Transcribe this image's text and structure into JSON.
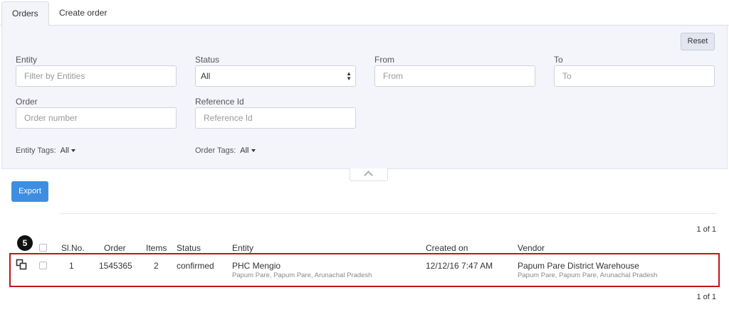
{
  "tabs": [
    {
      "label": "Orders",
      "active": true
    },
    {
      "label": "Create order",
      "active": false
    }
  ],
  "filters": {
    "reset_label": "Reset",
    "entity": {
      "label": "Entity",
      "placeholder": "Filter by Entities"
    },
    "status": {
      "label": "Status",
      "value": "All"
    },
    "from": {
      "label": "From",
      "placeholder": "From"
    },
    "to": {
      "label": "To",
      "placeholder": "To"
    },
    "order": {
      "label": "Order",
      "placeholder": "Order number"
    },
    "reference": {
      "label": "Reference Id",
      "placeholder": "Reference Id"
    },
    "entity_tags": {
      "label": "Entity Tags:",
      "value": "All"
    },
    "order_tags": {
      "label": "Order Tags:",
      "value": "All"
    }
  },
  "export_label": "Export",
  "pagination_top": "1 of 1",
  "pagination_bottom": "1 of 1",
  "step_marker": "5",
  "table": {
    "headers": {
      "slno": "Sl.No.",
      "order": "Order",
      "items": "Items",
      "status": "Status",
      "entity": "Entity",
      "created_on": "Created on",
      "vendor": "Vendor"
    },
    "rows": [
      {
        "slno": "1",
        "order": "1545365",
        "items": "2",
        "status": "confirmed",
        "entity_name": "PHC Mengio",
        "entity_location": "Papum Pare, Papum Pare, Arunachal Pradesh",
        "created_on": "12/12/16 7:47 AM",
        "vendor_name": "Papum Pare District Warehouse",
        "vendor_location": "Papum Pare, Papum Pare, Arunachal Pradesh"
      }
    ]
  },
  "colors": {
    "accent": "#3d8ee3",
    "highlight": "#c0141b",
    "panel_bg": "#f4f4fb"
  },
  "icons": {
    "row_action": "copy-icon",
    "collapse": "chevron-up-icon"
  }
}
